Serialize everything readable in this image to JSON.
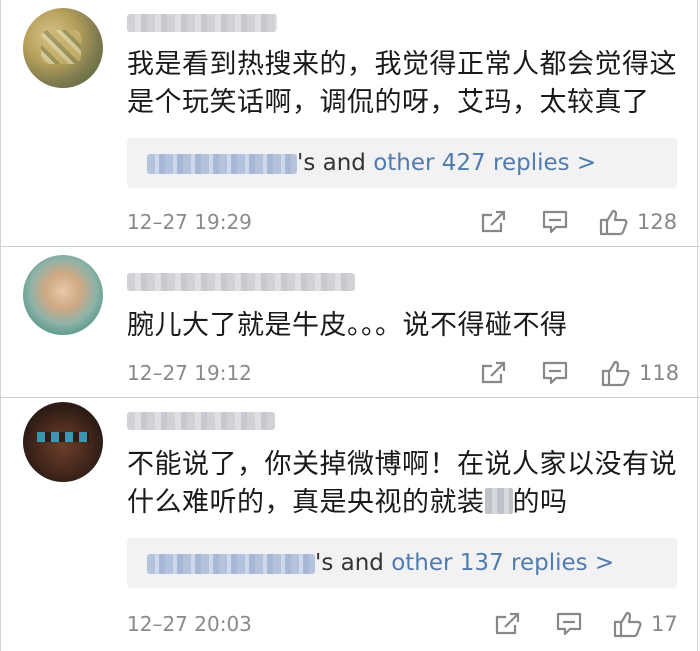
{
  "comments": [
    {
      "text": "我是看到热搜来的，我觉得正常人都会觉得这是个玩笑话啊，调侃的呀，艾玛，太较真了",
      "replies": {
        "prefix": "'s and ",
        "link": "other 427 replies >"
      },
      "time": "12–27 19:29",
      "likes": "128"
    },
    {
      "text": "腕儿大了就是牛皮。。。说不得碰不得",
      "time": "12–27 19:12",
      "likes": "118"
    },
    {
      "text_before": "不能说了，你关掉微博啊！在说人家以没有说什么难听的，真是央视的就装",
      "text_after": "的吗",
      "replies": {
        "prefix": "'s and ",
        "link": "other 137 replies >"
      },
      "time": "12–27 20:03",
      "likes": "17"
    }
  ],
  "icons": {
    "share": "share-icon",
    "comment": "comment-icon",
    "like": "thumbs-up-icon"
  },
  "colors": {
    "link": "#507cad",
    "reply_bg": "#f2f2f5",
    "meta": "#8a8a8a"
  }
}
